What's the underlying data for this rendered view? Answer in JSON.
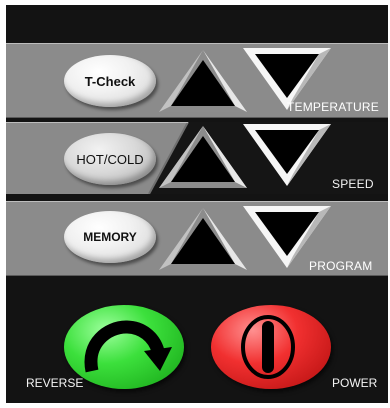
{
  "rows": [
    {
      "button_label": "T-Check",
      "label": "TEMPERATURE"
    },
    {
      "button_label": "HOT/COLD",
      "label": "SPEED"
    },
    {
      "button_label": "MEMORY",
      "label": "PROGRAM"
    }
  ],
  "bottom": {
    "reverse_label": "REVERSE",
    "power_label": "POWER"
  },
  "icons": {
    "up": "triangle-up-icon",
    "down": "triangle-down-icon",
    "reverse": "curved-arrow-icon",
    "power": "power-bar-icon"
  },
  "colors": {
    "panel": "#131313",
    "strip": "#8a8a8a",
    "oval_button": "#eeeeee",
    "reverse_button": "#2ed32e",
    "power_button": "#ee1c1c"
  }
}
